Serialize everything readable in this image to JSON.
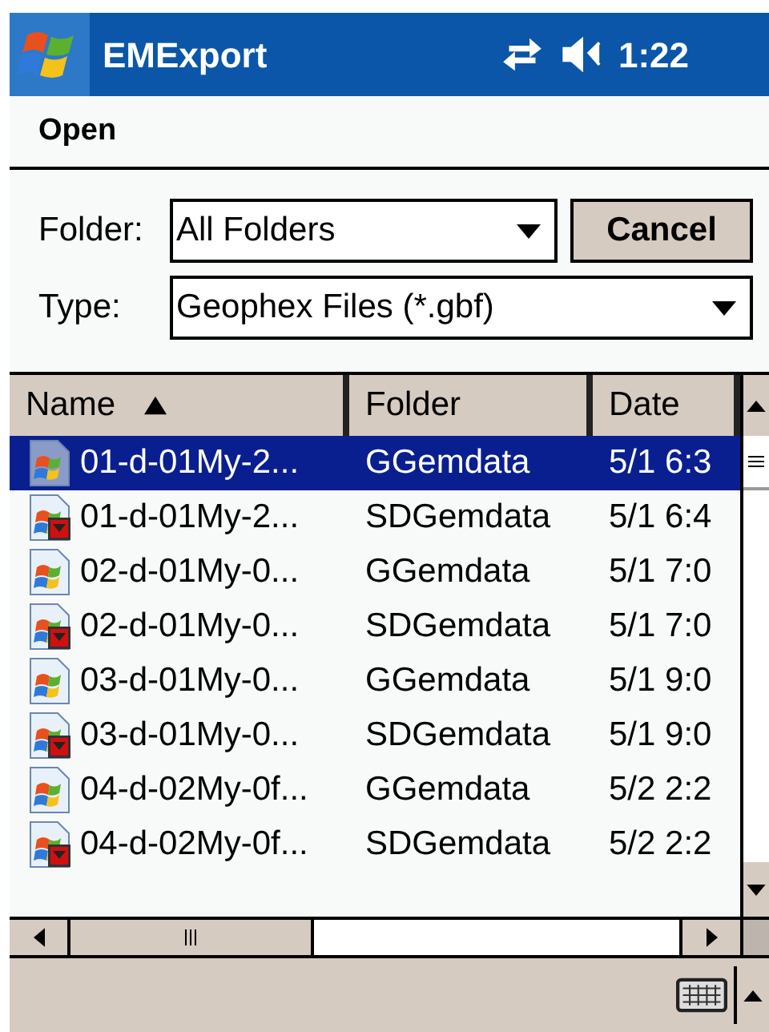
{
  "title_bar": {
    "title": "EMExport",
    "time": "1:22"
  },
  "menu": {
    "title": "Open"
  },
  "folder": {
    "label": "Folder:",
    "value": "All Folders"
  },
  "cancel_button": "Cancel",
  "type": {
    "label": "Type:",
    "value": "Geophex Files (*.gbf)"
  },
  "table": {
    "columns": [
      {
        "label": "Name",
        "sorted": true
      },
      {
        "label": "Folder"
      },
      {
        "label": "Date"
      }
    ],
    "rows": [
      {
        "name": "01-d-01My-2...",
        "folder": "GGemdata",
        "date": "5/1 6:3",
        "kind": "main",
        "selected": true
      },
      {
        "name": "01-d-01My-2...",
        "folder": "SDGemdata",
        "date": "5/1 6:4",
        "kind": "card",
        "selected": false
      },
      {
        "name": "02-d-01My-0...",
        "folder": "GGemdata",
        "date": "5/1 7:0",
        "kind": "main",
        "selected": false
      },
      {
        "name": "02-d-01My-0...",
        "folder": "SDGemdata",
        "date": "5/1 7:0",
        "kind": "card",
        "selected": false
      },
      {
        "name": "03-d-01My-0...",
        "folder": "GGemdata",
        "date": "5/1 9:0",
        "kind": "main",
        "selected": false
      },
      {
        "name": "03-d-01My-0...",
        "folder": "SDGemdata",
        "date": "5/1 9:0",
        "kind": "card",
        "selected": false
      },
      {
        "name": "04-d-02My-0f...",
        "folder": "GGemdata",
        "date": "5/2 2:2",
        "kind": "main",
        "selected": false
      },
      {
        "name": "04-d-02My-0f...",
        "folder": "SDGemdata",
        "date": "5/2 2:2",
        "kind": "card",
        "selected": false
      }
    ]
  }
}
